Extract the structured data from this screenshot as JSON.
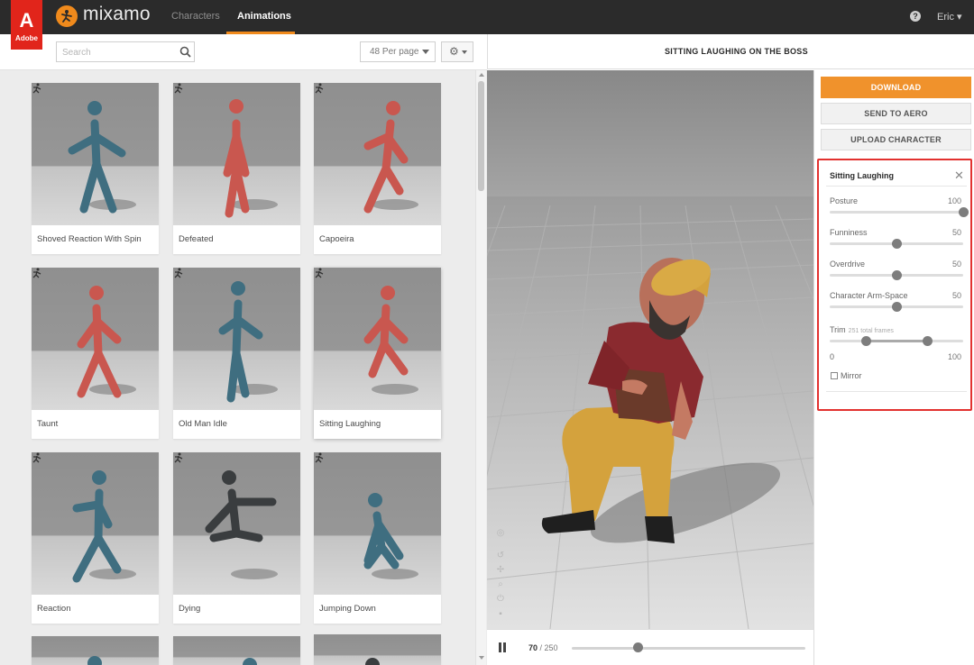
{
  "brand": {
    "adobe_glyph": "A",
    "adobe_word": "Adobe",
    "name": "mixamo"
  },
  "nav": {
    "tabs": [
      {
        "label": "Characters",
        "active": false
      },
      {
        "label": "Animations",
        "active": true
      }
    ],
    "help": "?",
    "user": "Eric ▾"
  },
  "toolbar": {
    "search_placeholder": "Search",
    "per_page": "48 Per page",
    "gear": "⚙"
  },
  "viewer": {
    "title": "SITTING LAUGHING ON THE BOSS",
    "current_frame": "70",
    "frame_total": " / 250",
    "timeline_progress": 0.28
  },
  "actions": {
    "download": "DOWNLOAD",
    "send": "SEND TO AERO",
    "upload": "UPLOAD CHARACTER"
  },
  "settings": {
    "title": "Sitting Laughing",
    "close": "✕",
    "params": [
      {
        "label": "Posture",
        "value": "100",
        "fraction": 1.0
      },
      {
        "label": "Funniness",
        "value": "50",
        "fraction": 0.5
      },
      {
        "label": "Overdrive",
        "value": "50",
        "fraction": 0.5
      },
      {
        "label": "Character Arm-Space",
        "value": "50",
        "fraction": 0.5
      }
    ],
    "trim": {
      "label": "Trim",
      "note": "251 total frames",
      "min_label": "0",
      "max_label": "100",
      "start_fraction": 0.27,
      "end_fraction": 0.73
    },
    "mirror": {
      "label": "Mirror",
      "checked": false
    }
  },
  "animations": [
    {
      "label": "Shoved Reaction With Spin",
      "color": "blue",
      "selected": false
    },
    {
      "label": "Defeated",
      "color": "red",
      "selected": false
    },
    {
      "label": "Capoeira",
      "color": "red",
      "selected": false
    },
    {
      "label": "Taunt",
      "color": "red",
      "selected": false
    },
    {
      "label": "Old Man Idle",
      "color": "blue",
      "selected": false
    },
    {
      "label": "Sitting Laughing",
      "color": "red",
      "selected": true
    },
    {
      "label": "Reaction",
      "color": "blue",
      "selected": false
    },
    {
      "label": "Dying",
      "color": "dark",
      "selected": false
    },
    {
      "label": "Jumping Down",
      "color": "blue",
      "selected": false
    }
  ],
  "colors": {
    "accent": "#f08a1c",
    "button_orange": "#f0922c",
    "highlight_border": "#e2312f",
    "mannequin_blue": "#3f6e80",
    "mannequin_red": "#c9574f",
    "dark_figure": "#3a3d3f"
  },
  "icons": {
    "brand": "mixamo-figure-icon",
    "search": "search-icon",
    "gear": "gear-icon",
    "close": "close-icon",
    "pause": "pause-icon",
    "motion": "motion-figure-icon"
  }
}
